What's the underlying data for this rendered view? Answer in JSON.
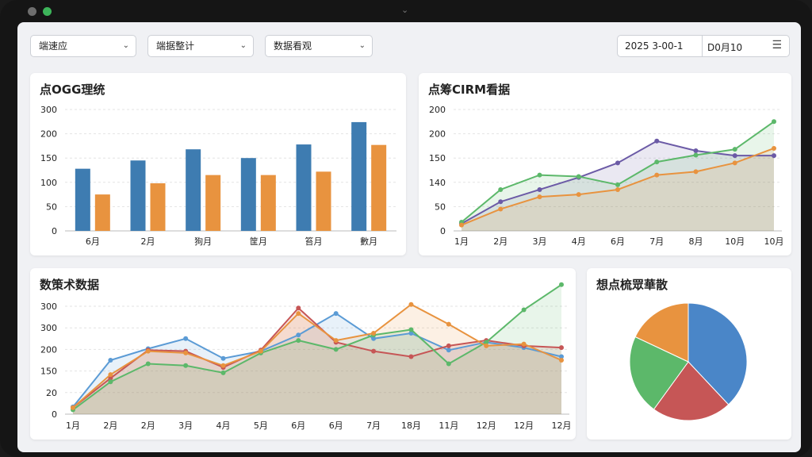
{
  "toolbar": {
    "filters": [
      {
        "label": "端速应"
      },
      {
        "label": "端据整计"
      },
      {
        "label": "数据看观"
      }
    ],
    "date_start": "2025 3-00-1",
    "date_end": "D0月10"
  },
  "colors": {
    "blue": "#3e7cb1",
    "orange": "#e8933f",
    "green": "#5cb86a",
    "purple": "#6b5aa6",
    "red": "#c65656",
    "lightblue": "#5b9bd5",
    "pie_blue": "#4a86c8"
  },
  "charts": {
    "bar": {
      "title": "点OGG理统"
    },
    "line": {
      "title": "点筹CIRM看据"
    },
    "multi": {
      "title": "数策术数据"
    },
    "pie": {
      "title": "想点梳眾華散"
    }
  },
  "chart_data": [
    {
      "type": "bar",
      "title": "点OGG理统",
      "categories": [
        "6月",
        "2月",
        "狗月",
        "筐月",
        "笞月",
        "數月"
      ],
      "yticks": [
        "0",
        "50",
        "100",
        "150",
        "200",
        "300"
      ],
      "ylim": [
        0,
        250
      ],
      "series": [
        {
          "values": [
            128,
            145,
            168,
            150,
            178,
            224
          ]
        },
        {
          "values": [
            75,
            98,
            115,
            115,
            122,
            177
          ]
        }
      ]
    },
    {
      "type": "line",
      "title": "点筹CIRM看据",
      "categories": [
        "1月",
        "2月",
        "3月",
        "4月",
        "6月",
        "7月",
        "8月",
        "10月",
        "10月"
      ],
      "yticks": [
        "0",
        "50",
        "140",
        "150",
        "200",
        "200"
      ],
      "ylim": [
        0,
        250
      ],
      "series": [
        {
          "values": [
            15,
            60,
            85,
            110,
            140,
            185,
            165,
            155,
            155
          ]
        },
        {
          "values": [
            18,
            85,
            115,
            112,
            95,
            142,
            156,
            168,
            225
          ]
        },
        {
          "values": [
            12,
            45,
            70,
            75,
            85,
            115,
            122,
            140,
            170
          ]
        }
      ]
    },
    {
      "type": "line",
      "title": "数策术数据",
      "categories": [
        "1月",
        "2月",
        "2月",
        "3月",
        "4月",
        "5月",
        "6月",
        "6月",
        "7月",
        "18月",
        "11月",
        "12月",
        "12月",
        "12月"
      ],
      "yticks": [
        "0",
        "20",
        "150",
        "200",
        "300",
        "300"
      ],
      "ylim": [
        0,
        300
      ],
      "series": [
        {
          "values": [
            20,
            150,
            182,
            210,
            155,
            175,
            220,
            280,
            210,
            225,
            178,
            200,
            185,
            160
          ]
        },
        {
          "values": [
            18,
            100,
            178,
            175,
            130,
            178,
            295,
            200,
            175,
            160,
            190,
            205,
            190,
            185
          ]
        },
        {
          "values": [
            12,
            90,
            140,
            135,
            115,
            170,
            205,
            180,
            220,
            235,
            140,
            200,
            290,
            360
          ]
        },
        {
          "values": [
            18,
            110,
            175,
            170,
            135,
            175,
            280,
            205,
            225,
            305,
            250,
            190,
            195,
            150
          ]
        }
      ]
    },
    {
      "type": "pie",
      "title": "想点梳眾華散",
      "values": [
        38,
        22,
        22,
        18
      ]
    }
  ]
}
